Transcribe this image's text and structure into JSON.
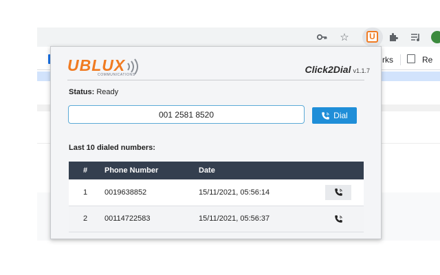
{
  "browser": {
    "bookmarks": [
      {
        "label": "rks"
      },
      {
        "label": "Re"
      }
    ],
    "icons": [
      "key-icon",
      "star-icon",
      "ublux-extension-icon",
      "puzzle-icon",
      "media-icon"
    ]
  },
  "popup": {
    "logo_text": "UBLUX",
    "logo_subtext": "COMMUNICATIONS",
    "title": "Click2Dial",
    "version": "v1.1.7",
    "status_label": "Status:",
    "status_value": "Ready",
    "phone_input_value": "001 2581 8520",
    "dial_button_label": "Dial",
    "history_label": "Last 10 dialed numbers:",
    "table": {
      "headers": [
        "#",
        "Phone Number",
        "Date",
        ""
      ],
      "rows": [
        {
          "num": "1",
          "phone": "0019638852",
          "date": "15/11/2021, 05:56:14"
        },
        {
          "num": "2",
          "phone": "00114722583",
          "date": "15/11/2021, 05:56:37"
        }
      ]
    }
  },
  "colors": {
    "brand_orange": "#f07b22",
    "dial_blue": "#1f8ed8",
    "table_header": "#343f4f"
  }
}
